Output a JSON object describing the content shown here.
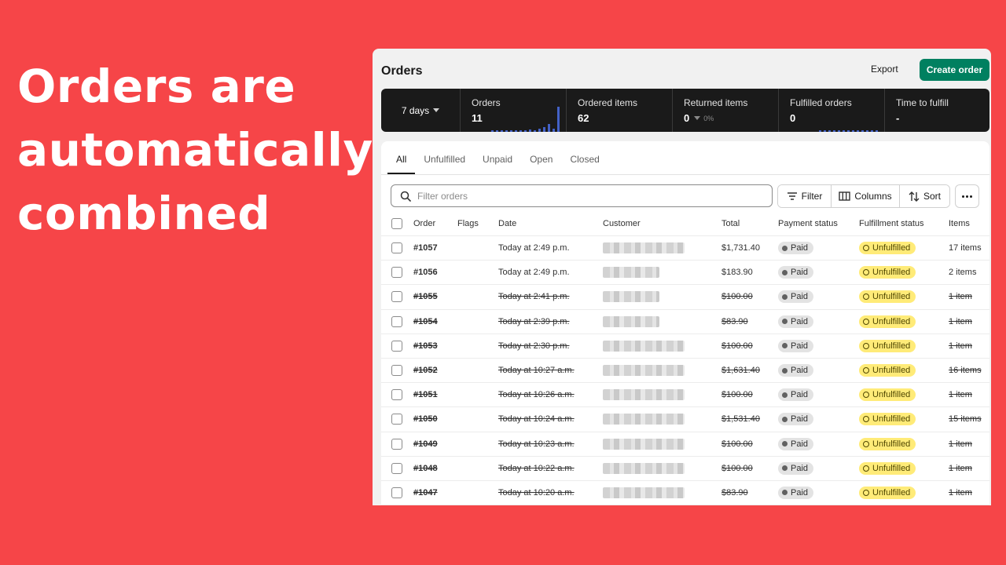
{
  "headline": [
    "Orders are",
    "automatically",
    "combined"
  ],
  "header": {
    "title": "Orders",
    "export_label": "Export",
    "create_label": "Create order"
  },
  "metrics": {
    "range_label": "7 days",
    "items": [
      {
        "label": "Orders",
        "value": "11",
        "delta": ""
      },
      {
        "label": "Ordered items",
        "value": "62",
        "delta": ""
      },
      {
        "label": "Returned items",
        "value": "0",
        "delta": "0%"
      },
      {
        "label": "Fulfilled orders",
        "value": "0",
        "delta": ""
      },
      {
        "label": "Time to fulfill",
        "value": "-",
        "delta": ""
      }
    ]
  },
  "tabs": [
    "All",
    "Unfulfilled",
    "Unpaid",
    "Open",
    "Closed"
  ],
  "active_tab": "All",
  "search": {
    "placeholder": "Filter orders"
  },
  "toolbar": {
    "filter_label": "Filter",
    "columns_label": "Columns",
    "sort_label": "Sort"
  },
  "columns": [
    "Order",
    "Flags",
    "Date",
    "Customer",
    "Total",
    "Payment status",
    "Fulfillment status",
    "Items"
  ],
  "orders": [
    {
      "order": "#1057",
      "date": "Today at 2:49 p.m.",
      "total": "$1,731.40",
      "payment": "Paid",
      "fulfillment": "Unfulfilled",
      "items": "17 items",
      "struck": false
    },
    {
      "order": "#1056",
      "date": "Today at 2:49 p.m.",
      "total": "$183.90",
      "payment": "Paid",
      "fulfillment": "Unfulfilled",
      "items": "2 items",
      "struck": false
    },
    {
      "order": "#1055",
      "date": "Today at 2:41 p.m.",
      "total": "$100.00",
      "payment": "Paid",
      "fulfillment": "Unfulfilled",
      "items": "1 item",
      "struck": true
    },
    {
      "order": "#1054",
      "date": "Today at 2:39 p.m.",
      "total": "$83.90",
      "payment": "Paid",
      "fulfillment": "Unfulfilled",
      "items": "1 item",
      "struck": true
    },
    {
      "order": "#1053",
      "date": "Today at 2:30 p.m.",
      "total": "$100.00",
      "payment": "Paid",
      "fulfillment": "Unfulfilled",
      "items": "1 item",
      "struck": true
    },
    {
      "order": "#1052",
      "date": "Today at 10:27 a.m.",
      "total": "$1,631.40",
      "payment": "Paid",
      "fulfillment": "Unfulfilled",
      "items": "16 items",
      "struck": true
    },
    {
      "order": "#1051",
      "date": "Today at 10:26 a.m.",
      "total": "$100.00",
      "payment": "Paid",
      "fulfillment": "Unfulfilled",
      "items": "1 item",
      "struck": true
    },
    {
      "order": "#1050",
      "date": "Today at 10:24 a.m.",
      "total": "$1,531.40",
      "payment": "Paid",
      "fulfillment": "Unfulfilled",
      "items": "15 items",
      "struck": true
    },
    {
      "order": "#1049",
      "date": "Today at 10:23 a.m.",
      "total": "$100.00",
      "payment": "Paid",
      "fulfillment": "Unfulfilled",
      "items": "1 item",
      "struck": true
    },
    {
      "order": "#1048",
      "date": "Today at 10:22 a.m.",
      "total": "$100.00",
      "payment": "Paid",
      "fulfillment": "Unfulfilled",
      "items": "1 item",
      "struck": true
    },
    {
      "order": "#1047",
      "date": "Today at 10:20 a.m.",
      "total": "$83.90",
      "payment": "Paid",
      "fulfillment": "Unfulfilled",
      "items": "1 item",
      "struck": true
    }
  ],
  "colors": {
    "background": "#f64548",
    "primary_button": "#008060",
    "metrics_bg": "#1a1a1a",
    "sparkline": "#4361c7",
    "paid_badge": "#e3e3e3",
    "unfulfilled_badge": "#ffeb78"
  }
}
